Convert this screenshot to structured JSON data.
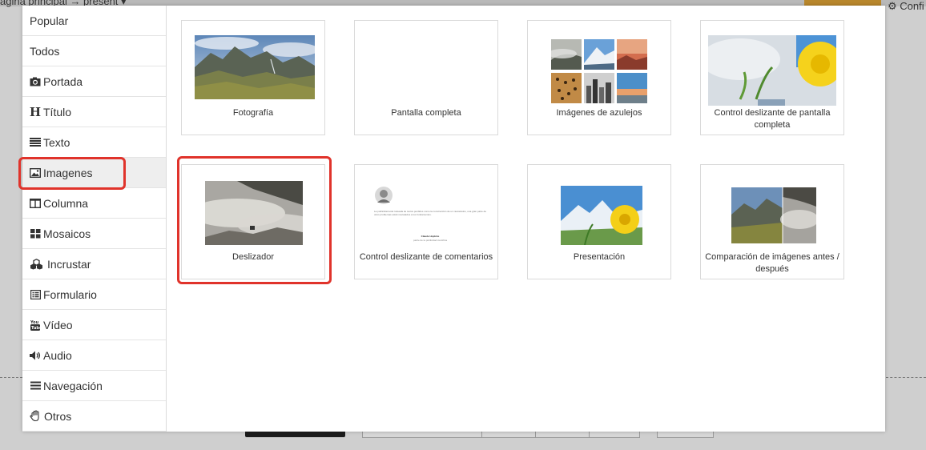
{
  "background": {
    "breadcrumb": "ágina principal → present ▾",
    "config_label": "⚙ Confi"
  },
  "sidebar": {
    "items": [
      {
        "label": "Popular",
        "icon": "none"
      },
      {
        "label": "Todos",
        "icon": "none"
      },
      {
        "label": "Portada",
        "icon": "camera-icon"
      },
      {
        "label": "Título",
        "icon": "heading-icon",
        "glyph": "H"
      },
      {
        "label": "Texto",
        "icon": "text-lines-icon"
      },
      {
        "label": "Imagenes",
        "icon": "image-icon",
        "active": true
      },
      {
        "label": "Columna",
        "icon": "columns-icon"
      },
      {
        "label": "Mosaicos",
        "icon": "grid-icon"
      },
      {
        "label": "Incrustar",
        "icon": "cubes-icon"
      },
      {
        "label": "Formulario",
        "icon": "form-icon"
      },
      {
        "label": "Vídeo",
        "icon": "youtube-icon"
      },
      {
        "label": "Audio",
        "icon": "speaker-icon"
      },
      {
        "label": "Navegación",
        "icon": "menu-icon"
      },
      {
        "label": "Otros",
        "icon": "hand-icon"
      }
    ]
  },
  "cards": [
    {
      "label": "Fotografía"
    },
    {
      "label": "Pantalla completa"
    },
    {
      "label": "Imágenes de azulejos"
    },
    {
      "label": "Control deslizante de pantalla completa"
    },
    {
      "label": "Deslizador"
    },
    {
      "label": "Control deslizante de comentarios"
    },
    {
      "label": "Presentación"
    },
    {
      "label": "Comparación de imágenes antes / después"
    }
  ],
  "testimonial_preview": {
    "quote": "La publicidad está rodeada de textos perdidos como la construcción de un rascacielos, una gran parte de otros problemas están rescatados a tus fundamentos.",
    "author": "Claude Hopkins",
    "role": "padre de la publicidad científica"
  },
  "colors": {
    "highlight": "#e0332b",
    "active_item_bg": "#eeeeee"
  }
}
